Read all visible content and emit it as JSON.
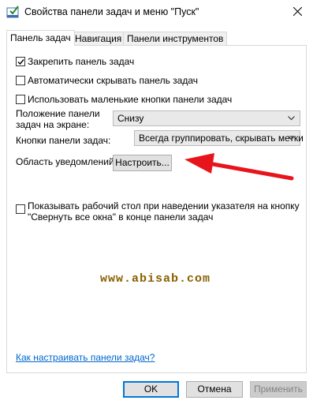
{
  "window": {
    "title": "Свойства панели задач и меню \"Пуск\""
  },
  "tabs": [
    {
      "label": "Панель задач",
      "active": true
    },
    {
      "label": "Навигация",
      "active": false
    },
    {
      "label": "Панели инструментов",
      "active": false
    }
  ],
  "options": {
    "lock_taskbar": {
      "label": "Закрепить панель задач",
      "checked": true
    },
    "autohide": {
      "label": "Автоматически скрывать панель задач",
      "checked": false
    },
    "small_buttons": {
      "label": "Использовать маленькие кнопки панели задач",
      "checked": false
    },
    "position": {
      "label_line1": "Положение панели",
      "label_line2": "задач на экране:",
      "value": "Снизу"
    },
    "buttons": {
      "label": "Кнопки панели задач:",
      "value": "Всегда группировать, скрывать метки"
    },
    "notification": {
      "label": "Область уведомлений:",
      "button": "Настроить..."
    },
    "peek": {
      "label_line1": "Показывать рабочий стол при наведении указателя на кнопку",
      "label_line2": "\"Свернуть все окна\" в конце панели задач",
      "checked": false
    }
  },
  "watermark": "www.abisab.com",
  "help_link": "Как настраивать панели задач?",
  "footer": {
    "ok": "OK",
    "cancel": "Отмена",
    "apply": "Применить"
  },
  "colors": {
    "accent": "#0078d7",
    "link": "#0066cc",
    "annotation_arrow": "#e8141b",
    "watermark": "#8a6000"
  }
}
